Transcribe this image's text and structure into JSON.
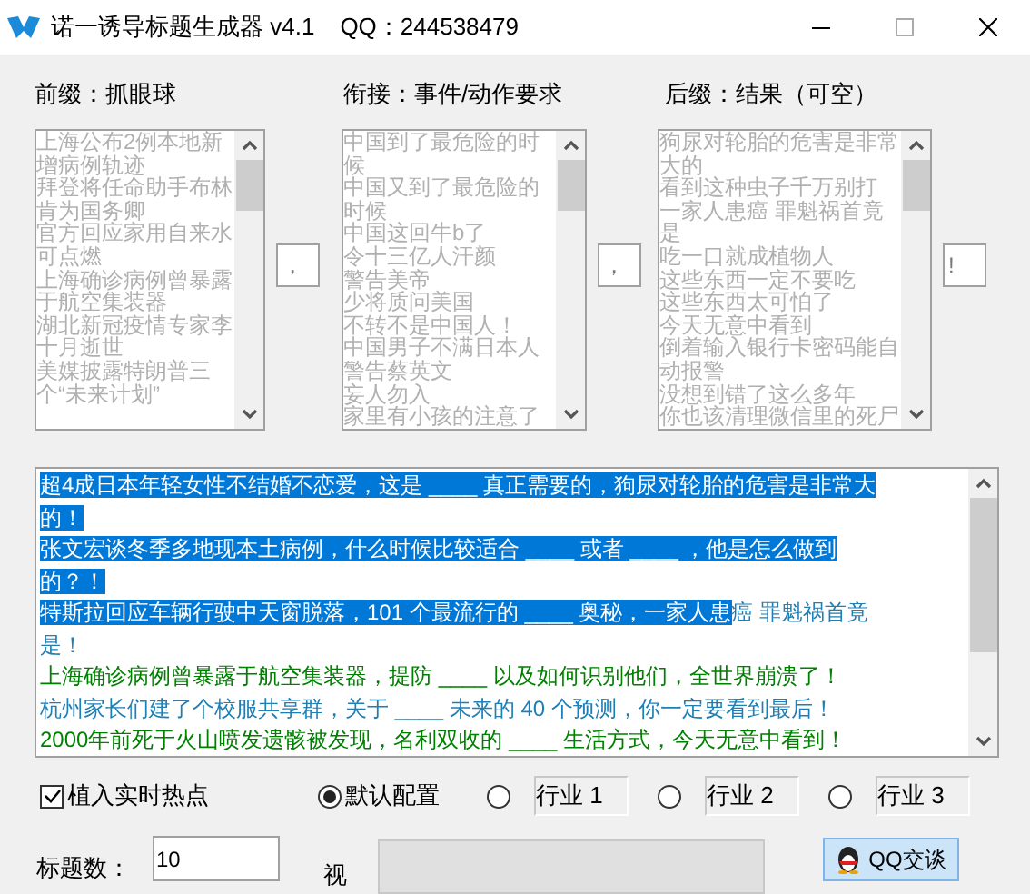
{
  "window": {
    "title": "诺一诱导标题生成器 v4.1",
    "qq": "QQ：244538479"
  },
  "columns": [
    {
      "label": "前缀：抓眼球",
      "separator": "，",
      "items": [
        "上海公布2例本地新增病例轨迹",
        "拜登将任命助手布林肯为国务卿",
        "官方回应家用自来水可点燃",
        "上海确诊病例曾暴露于航空集装器",
        "湖北新冠疫情专家李十月逝世",
        "美媒披露特朗普三个“未来计划”"
      ]
    },
    {
      "label": "衔接：事件/动作要求",
      "separator": "，",
      "items": [
        "中国到了最危险的时候",
        "中国又到了最危险的时候",
        "中国这回牛b了",
        "令十三亿人汗颜",
        "警告美帝",
        "少将质问美国",
        "不转不是中国人！",
        "中国男子不满日本人",
        "警告蔡英文",
        "妄人勿入",
        "家里有小孩的注意了"
      ]
    },
    {
      "label": "后缀：结果（可空）",
      "separator": "!",
      "items": [
        "狗尿对轮胎的危害是非常大的",
        "看到这种虫子千万别打",
        "一家人患癌 罪魁祸首竟是",
        "吃一口就成植物人",
        "这些东西一定不要吃",
        "这些东西太可怕了",
        "今天无意中看到",
        "倒着输入银行卡密码能自动报警",
        "没想到错了这么多年",
        "你也该清理微信里的死尸"
      ]
    }
  ],
  "output": [
    {
      "segments": [
        {
          "text": "超4成日本年轻女性不结婚不恋爱，这是 ____ 真正需要的，狗尿对轮胎的危害是非常大",
          "selected": true
        }
      ]
    },
    {
      "segments": [
        {
          "text": "的！",
          "selected": true
        }
      ]
    },
    {
      "segments": [
        {
          "text": "张文宏谈冬季多地现本土病例，什么时候比较适合 ____ 或者 ____ ，他是怎么做到",
          "selected": true
        }
      ]
    },
    {
      "segments": [
        {
          "text": "的？！",
          "selected": true
        }
      ]
    },
    {
      "color": "#1e7fb5",
      "segments": [
        {
          "text": "特斯拉回应车辆行驶中天窗脱落，101 个最流行的 ____ 奥秘，一家人患",
          "selected": true
        },
        {
          "text": "癌 罪魁祸首竟",
          "selected": false
        }
      ]
    },
    {
      "color": "#1e7fb5",
      "segments": [
        {
          "text": "是！",
          "selected": false
        }
      ]
    },
    {
      "color": "#008000",
      "segments": [
        {
          "text": "上海确诊病例曾暴露于航空集装器，提防 ____ 以及如何识别他们，全世界崩溃了！",
          "selected": false
        }
      ]
    },
    {
      "color": "#1e7fb5",
      "segments": [
        {
          "text": "杭州家长们建了个校服共享群，关于 ____ 未来的 40 个预测，你一定要看到最后！",
          "selected": false
        }
      ]
    },
    {
      "color": "#008000",
      "segments": [
        {
          "text": "2000年前死于火山喷发遗骸被发现，名利双收的 ____ 生活方式，今天无意中看到！",
          "selected": false
        }
      ]
    }
  ],
  "hotspot": {
    "label": "植入实时热点",
    "checked": true
  },
  "presets": [
    {
      "label": "默认配置",
      "selected": true,
      "kind": "plain"
    },
    {
      "label": "行业 1",
      "selected": false,
      "kind": "boxed"
    },
    {
      "label": "行业 2",
      "selected": false,
      "kind": "boxed"
    },
    {
      "label": "行业 3",
      "selected": false,
      "kind": "boxed"
    }
  ],
  "count": {
    "label": "标题数：",
    "value": "10"
  },
  "side_label": "视",
  "qq_button": "QQ交谈"
}
